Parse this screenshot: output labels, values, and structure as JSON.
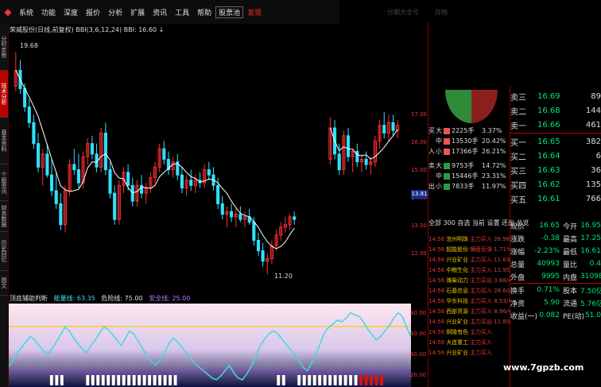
{
  "menu": {
    "items": [
      "系统",
      "功能",
      "深度",
      "报价",
      "分析",
      "扩展",
      "资讯",
      "工具",
      "帮助"
    ],
    "highlight_boxed": "股票池",
    "highlight": "发现"
  },
  "top_right": {
    "texts": [
      "分期大全号",
      "存档"
    ]
  },
  "left_tabs": [
    "分时走势",
    "技术分析",
    "基本资料",
    "个股资讯",
    "财务数据",
    "历史回忆",
    "图文"
  ],
  "chart_header": {
    "stock": "荣威股份(日线,前复权)",
    "indicator": "BBI(3,6,12,24)",
    "bbi_value": "BBI: 16.60",
    "arrow": "↓"
  },
  "chart_data": {
    "type": "candlestick",
    "price_axis_ticks": [
      "17.00",
      "16.00",
      "15.00",
      "14.00",
      "13.00",
      "12.00"
    ],
    "current_price_label": "13.81",
    "high_label": "19.68",
    "low_label": "11.20",
    "candles": [
      [
        18.4,
        19.7,
        18.2,
        19.0
      ],
      [
        19.0,
        19.4,
        18.1,
        18.3
      ],
      [
        18.3,
        18.5,
        17.4,
        17.6
      ],
      [
        17.6,
        17.9,
        16.8,
        17.0
      ],
      [
        17.0,
        17.3,
        16.0,
        16.2
      ],
      [
        16.2,
        16.6,
        15.1,
        15.3
      ],
      [
        15.3,
        16.0,
        14.6,
        15.8
      ],
      [
        15.8,
        16.2,
        14.9,
        15.0
      ],
      [
        15.0,
        15.6,
        14.2,
        14.4
      ],
      [
        14.4,
        15.1,
        13.7,
        13.9
      ],
      [
        13.9,
        14.3,
        12.9,
        13.1
      ],
      [
        13.1,
        14.6,
        12.8,
        14.4
      ],
      [
        14.4,
        15.6,
        14.2,
        15.4
      ],
      [
        15.4,
        16.0,
        15.0,
        15.2
      ],
      [
        15.2,
        15.8,
        14.5,
        14.7
      ],
      [
        14.7,
        15.9,
        14.5,
        15.7
      ],
      [
        15.7,
        16.4,
        15.4,
        16.2
      ],
      [
        16.2,
        16.5,
        15.6,
        15.8
      ],
      [
        15.8,
        16.2,
        15.1,
        15.3
      ],
      [
        15.3,
        16.8,
        15.1,
        16.6
      ],
      [
        16.6,
        17.0,
        15.0,
        15.2
      ],
      [
        15.2,
        15.5,
        14.1,
        14.3
      ],
      [
        14.3,
        14.6,
        13.1,
        13.3
      ],
      [
        13.3,
        14.8,
        13.1,
        14.6
      ],
      [
        14.6,
        15.3,
        14.3,
        15.1
      ],
      [
        15.1,
        15.4,
        14.4,
        14.6
      ],
      [
        14.6,
        14.9,
        13.8,
        14.0
      ],
      [
        14.0,
        14.8,
        13.8,
        14.6
      ],
      [
        14.6,
        15.0,
        14.1,
        14.3
      ],
      [
        14.3,
        14.7,
        13.9,
        14.5
      ],
      [
        14.5,
        15.1,
        14.3,
        14.9
      ],
      [
        14.9,
        15.5,
        14.7,
        15.3
      ],
      [
        15.3,
        16.2,
        15.1,
        16.0
      ],
      [
        16.0,
        16.3,
        15.4,
        15.6
      ],
      [
        15.6,
        15.9,
        15.0,
        15.2
      ],
      [
        15.2,
        15.7,
        14.9,
        15.5
      ],
      [
        15.5,
        15.8,
        14.8,
        15.0
      ],
      [
        15.0,
        15.3,
        14.3,
        14.5
      ],
      [
        14.5,
        15.0,
        14.2,
        14.8
      ],
      [
        14.8,
        15.2,
        14.4,
        14.6
      ],
      [
        14.6,
        15.0,
        14.3,
        14.8
      ],
      [
        14.8,
        15.1,
        14.5,
        14.7
      ],
      [
        14.7,
        15.4,
        14.5,
        15.2
      ],
      [
        15.2,
        15.5,
        14.8,
        15.0
      ],
      [
        15.0,
        15.3,
        14.4,
        14.6
      ],
      [
        14.6,
        14.9,
        13.7,
        13.9
      ],
      [
        13.9,
        14.2,
        13.3,
        13.5
      ],
      [
        13.5,
        13.8,
        13.0,
        13.6
      ],
      [
        13.6,
        13.9,
        13.2,
        13.4
      ],
      [
        13.4,
        13.7,
        13.0,
        13.5
      ],
      [
        13.5,
        13.8,
        13.2,
        13.3
      ],
      [
        13.3,
        13.6,
        13.0,
        13.4
      ],
      [
        13.4,
        13.7,
        13.1,
        13.2
      ],
      [
        13.2,
        13.4,
        12.3,
        12.5
      ],
      [
        12.5,
        12.8,
        11.9,
        12.1
      ],
      [
        12.1,
        12.4,
        11.5,
        11.7
      ],
      [
        11.7,
        12.0,
        11.2,
        11.8
      ],
      [
        11.8,
        12.5,
        11.6,
        12.3
      ],
      [
        12.3,
        12.9,
        12.1,
        12.7
      ],
      [
        12.7,
        13.2,
        12.5,
        13.0
      ],
      [
        13.0,
        13.4,
        12.8,
        13.1
      ],
      [
        13.1,
        13.5,
        12.9,
        13.4
      ],
      [
        13.4,
        13.6,
        13.1,
        13.3
      ],
      null,
      null,
      null,
      null,
      null,
      null,
      null,
      [
        15.6,
        17.2,
        15.4,
        16.8
      ],
      [
        16.8,
        17.1,
        15.6,
        15.8
      ],
      [
        15.8,
        16.2,
        15.0,
        15.2
      ],
      [
        15.2,
        16.7,
        15.0,
        16.5
      ],
      [
        16.5,
        16.8,
        15.5,
        15.7
      ],
      [
        15.7,
        16.0,
        15.1,
        15.9
      ],
      [
        15.9,
        16.2,
        15.3,
        15.5
      ],
      [
        15.5,
        15.8,
        15.1,
        15.6
      ],
      [
        15.6,
        15.9,
        15.2,
        15.4
      ],
      [
        15.4,
        15.7,
        15.0,
        15.5
      ],
      [
        15.5,
        16.5,
        15.3,
        16.3
      ],
      [
        16.3,
        17.1,
        16.0,
        16.9
      ],
      [
        16.9,
        17.4,
        16.4,
        16.6
      ],
      [
        16.6,
        17.3,
        16.3,
        17.0
      ],
      [
        17.0,
        17.3,
        16.5,
        16.7
      ],
      [
        16.7,
        17.1,
        16.4,
        16.9
      ]
    ]
  },
  "oscillator": {
    "title": "顶底辅助判断",
    "energy_label": "能量线: 63.35",
    "danger_label": "危险线: 75.00",
    "safe_label": "安全线: 25.00",
    "axis_ticks": [
      "80.00",
      "60.00",
      "40.00",
      "20.00"
    ],
    "danger_level": 75,
    "safe_level": 25,
    "series": [
      30,
      38,
      46,
      52,
      58,
      64,
      60,
      54,
      48,
      44,
      50,
      58,
      66,
      74,
      70,
      62,
      56,
      50,
      46,
      54,
      60,
      68,
      74,
      72,
      66,
      60,
      54,
      62,
      70,
      66,
      58,
      50,
      42,
      36,
      32,
      38,
      46,
      56,
      62,
      58,
      52,
      46,
      40,
      34,
      30,
      26,
      22,
      18,
      16,
      20,
      26,
      32,
      24,
      18,
      16,
      22,
      30,
      40,
      52,
      60,
      66,
      70,
      68,
      62,
      56,
      50,
      44,
      38,
      30,
      26,
      34,
      44,
      56,
      68,
      74,
      78,
      82,
      80,
      84,
      90,
      88,
      86,
      80,
      72,
      66,
      60,
      64,
      70,
      76,
      84,
      90,
      86,
      74,
      63
    ],
    "bottom_marks_white": [
      8,
      9,
      10,
      15,
      16,
      17,
      18,
      19,
      20,
      21,
      22,
      23,
      24,
      25,
      26,
      27,
      28,
      29,
      30,
      31,
      32,
      52,
      53,
      56,
      57,
      58,
      59,
      60,
      61,
      62,
      63,
      64,
      65,
      66,
      67
    ],
    "bottom_marks_red": [
      68,
      69,
      70,
      71,
      72
    ]
  },
  "pie": {
    "colors": [
      "#2e8b3a",
      "#8b1e1e"
    ]
  },
  "capital_flow": {
    "rows": [
      {
        "side": "买",
        "lab": "大",
        "vol": "2225手",
        "pct": "3.37%",
        "color": "#e55"
      },
      {
        "side": "",
        "lab": "中",
        "vol": "13530手",
        "pct": "20.42%",
        "color": "#e55"
      },
      {
        "side": "入",
        "lab": "小",
        "vol": "17366手",
        "pct": "26.21%",
        "color": "#e55"
      },
      {
        "side": "卖",
        "lab": "大",
        "vol": "9753手",
        "pct": "14.72%",
        "color": "#2a9d3a"
      },
      {
        "side": "",
        "lab": "中",
        "vol": "15446手",
        "pct": "23.31%",
        "color": "#2a9d3a"
      },
      {
        "side": "出",
        "lab": "小",
        "vol": "7833手",
        "pct": "11.97%",
        "color": "#2a9d3a"
      }
    ],
    "total": "全部 300 自选 当前 设置 还出 总览"
  },
  "trades": [
    {
      "t": "14:56",
      "n": "沧州明珠",
      "a": "主力买入",
      "v": "26.98/2154"
    },
    {
      "t": "14:56",
      "n": "韶能股份",
      "a": "横盘反弹",
      "v": "1.71%"
    },
    {
      "t": "14:56",
      "n": "兴业矿业",
      "a": "主力买入",
      "v": "11.63/4051"
    },
    {
      "t": "14:56",
      "n": "中粮生化",
      "a": "主力买入",
      "v": "11.95/3753"
    },
    {
      "t": "14:56",
      "n": "潍柴动力",
      "a": "主力买出",
      "v": "3.88/4470"
    },
    {
      "t": "14:56",
      "n": "石基信息",
      "a": "主力买入",
      "v": "28.60/5768"
    },
    {
      "t": "14:56",
      "n": "华东科技",
      "a": "主力买入",
      "v": "8.53/4015"
    },
    {
      "t": "14:56",
      "n": "西部资源",
      "a": "主力买入",
      "v": "8.96/4000"
    },
    {
      "t": "14:56",
      "n": "兴业矿业",
      "a": "主力买出",
      "v": "11.60/7410"
    },
    {
      "t": "14:56",
      "n": "铜陵有色",
      "a": "主力买入",
      "v": ""
    },
    {
      "t": "14:56",
      "n": "大连重工",
      "a": "主力买入",
      "v": ""
    },
    {
      "t": "14:56",
      "n": "兴业矿业",
      "a": "主力买入",
      "v": ""
    }
  ],
  "order_book": {
    "sells": [
      {
        "lab": "卖三",
        "price": "16.69",
        "vol": "89"
      },
      {
        "lab": "卖二",
        "price": "16.68",
        "vol": "144"
      },
      {
        "lab": "卖一",
        "price": "16.66",
        "vol": "461"
      }
    ],
    "buys": [
      {
        "lab": "买一",
        "price": "16.65",
        "vol": "382"
      },
      {
        "lab": "买二",
        "price": "16.64",
        "vol": "6"
      },
      {
        "lab": "买三",
        "price": "16.63",
        "vol": "36"
      },
      {
        "lab": "买四",
        "price": "16.62",
        "vol": "135"
      },
      {
        "lab": "买五",
        "price": "16.61",
        "vol": "766"
      }
    ]
  },
  "quote": [
    {
      "k": "现价",
      "v": "16.65",
      "k2": "今开",
      "v2": "16.95"
    },
    {
      "k": "涨跌",
      "v": "-0.38",
      "k2": "最高",
      "v2": "17.25"
    },
    {
      "k": "涨幅",
      "v": "-2.23%",
      "k2": "最低",
      "v2": "16.61"
    },
    {
      "k": "总量",
      "v": "40993",
      "k2": "量比",
      "v2": "0.4"
    },
    {
      "k": "外盘",
      "v": "9995",
      "k2": "内盘",
      "v2": "31098"
    },
    {
      "k": "换手",
      "v": "0.71%",
      "k2": "股本",
      "v2": "7.50亿"
    },
    {
      "k": "净资",
      "v": "5.90",
      "k2": "流通",
      "v2": "5.76亿"
    },
    {
      "k": "收益(一)",
      "v": "0.082",
      "k2": "PE(动)",
      "v2": "51.0"
    }
  ],
  "watermark": "www.7gpzb.com"
}
